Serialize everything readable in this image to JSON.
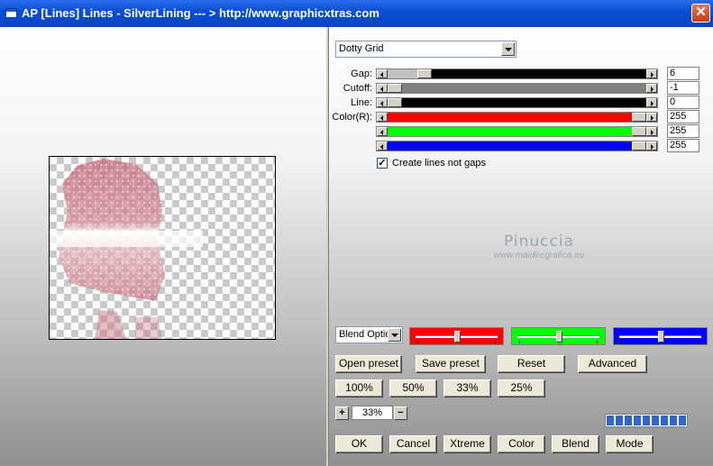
{
  "window": {
    "title": "AP [Lines]  Lines - SilverLining     --- > http://www.graphicxtras.com",
    "close_label": "✕"
  },
  "preset_dropdown": {
    "value": "Dotty Grid"
  },
  "sliders": [
    {
      "label": "Gap:",
      "value": "6",
      "color": "#000000",
      "level": 0.12
    },
    {
      "label": "Cutoff:",
      "value": "-1",
      "color": "#808080",
      "level": 0.0
    },
    {
      "label": "Line:",
      "value": "0",
      "color": "#000000",
      "level": 0.0
    },
    {
      "label": "Color(R):",
      "value": "255",
      "color": "#ff0000",
      "level": 1.0
    },
    {
      "label": "",
      "value": "255",
      "color": "#00ff00",
      "level": 1.0
    },
    {
      "label": "",
      "value": "255",
      "color": "#0000ff",
      "level": 1.0
    }
  ],
  "create_lines_checkbox": {
    "label": "Create lines not gaps",
    "checked": true,
    "mark": "✓"
  },
  "watermark": {
    "name": "Pinuccia",
    "url": "www.maidiregrafica.eu"
  },
  "blend_dropdown": {
    "value": "Blend Optio"
  },
  "color_sliders": [
    {
      "color": "#ff0000",
      "level": 0.5
    },
    {
      "color": "#00ff00",
      "level": 0.5
    },
    {
      "color": "#0000ff",
      "level": 0.5
    }
  ],
  "buttons_row1": [
    "Open preset",
    "Save preset",
    "Reset",
    "Advanced"
  ],
  "zoom_buttons": [
    "100%",
    "50%",
    "33%",
    "25%"
  ],
  "zoom": {
    "plus": "+",
    "value": "33%",
    "minus": "−"
  },
  "progress_segments": 9,
  "bottom_buttons": [
    "OK",
    "Cancel",
    "Xtreme",
    "Color",
    "Blend",
    "Mode"
  ]
}
